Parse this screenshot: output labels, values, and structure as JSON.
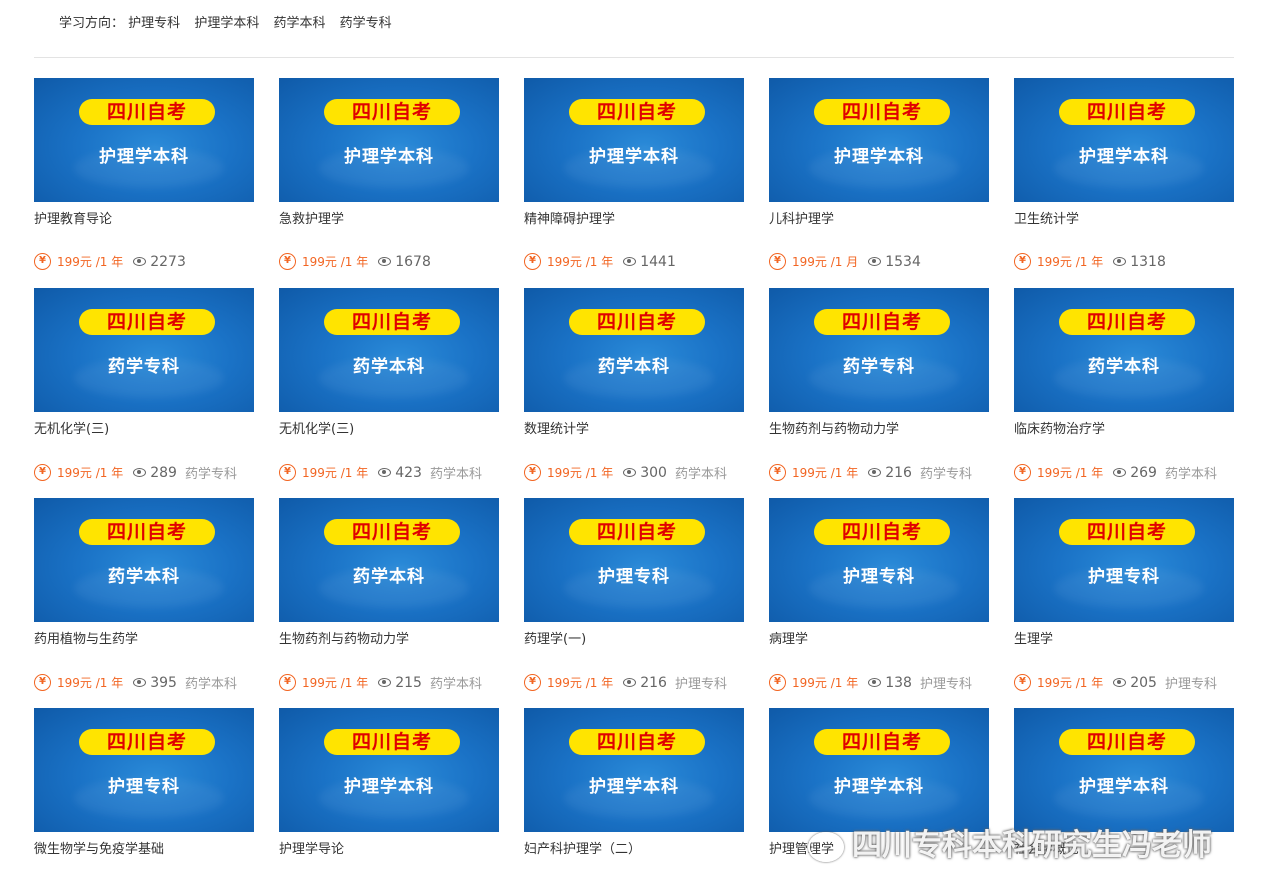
{
  "filter": {
    "label": "学习方向：",
    "options": [
      "护理专科",
      "护理学本科",
      "药学本科",
      "药学专科"
    ]
  },
  "badge_text": "四川自考",
  "price_icon": "¥",
  "courses": [
    {
      "subtitle": "护理学本科",
      "title": "护理教育导论",
      "price": "199元 /1 年",
      "views": "2273",
      "category": ""
    },
    {
      "subtitle": "护理学本科",
      "title": "急救护理学",
      "price": "199元 /1 年",
      "views": "1678",
      "category": ""
    },
    {
      "subtitle": "护理学本科",
      "title": "精神障碍护理学",
      "price": "199元 /1 年",
      "views": "1441",
      "category": ""
    },
    {
      "subtitle": "护理学本科",
      "title": "儿科护理学",
      "price": "199元 /1 月",
      "views": "1534",
      "category": ""
    },
    {
      "subtitle": "护理学本科",
      "title": "卫生统计学",
      "price": "199元 /1 年",
      "views": "1318",
      "category": ""
    },
    {
      "subtitle": "药学专科",
      "title": "无机化学(三)",
      "price": "199元 /1 年",
      "views": "289",
      "category": "药学专科"
    },
    {
      "subtitle": "药学本科",
      "title": "无机化学(三)",
      "price": "199元 /1 年",
      "views": "423",
      "category": "药学本科"
    },
    {
      "subtitle": "药学本科",
      "title": "数理统计学",
      "price": "199元 /1 年",
      "views": "300",
      "category": "药学本科"
    },
    {
      "subtitle": "药学专科",
      "title": "生物药剂与药物动力学",
      "price": "199元 /1 年",
      "views": "216",
      "category": "药学专科"
    },
    {
      "subtitle": "药学本科",
      "title": "临床药物治疗学",
      "price": "199元 /1 年",
      "views": "269",
      "category": "药学本科"
    },
    {
      "subtitle": "药学本科",
      "title": "药用植物与生药学",
      "price": "199元 /1 年",
      "views": "395",
      "category": "药学本科"
    },
    {
      "subtitle": "药学本科",
      "title": "生物药剂与药物动力学",
      "price": "199元 /1 年",
      "views": "215",
      "category": "药学本科"
    },
    {
      "subtitle": "护理专科",
      "title": "药理学(一)",
      "price": "199元 /1 年",
      "views": "216",
      "category": "护理专科"
    },
    {
      "subtitle": "护理专科",
      "title": "病理学",
      "price": "199元 /1 年",
      "views": "138",
      "category": "护理专科"
    },
    {
      "subtitle": "护理专科",
      "title": "生理学",
      "price": "199元 /1 年",
      "views": "205",
      "category": "护理专科"
    },
    {
      "subtitle": "护理专科",
      "title": "微生物学与免疫学基础",
      "price": "",
      "views": "",
      "category": ""
    },
    {
      "subtitle": "护理学本科",
      "title": "护理学导论",
      "price": "",
      "views": "",
      "category": ""
    },
    {
      "subtitle": "护理学本科",
      "title": "妇产科护理学（二）",
      "price": "",
      "views": "",
      "category": ""
    },
    {
      "subtitle": "护理学本科",
      "title": "护理管理学",
      "price": "",
      "views": "",
      "category": ""
    },
    {
      "subtitle": "护理学本科",
      "title": "社会学概论",
      "price": "",
      "views": "",
      "category": ""
    }
  ],
  "watermark": "四川专科本科研究生冯老师"
}
